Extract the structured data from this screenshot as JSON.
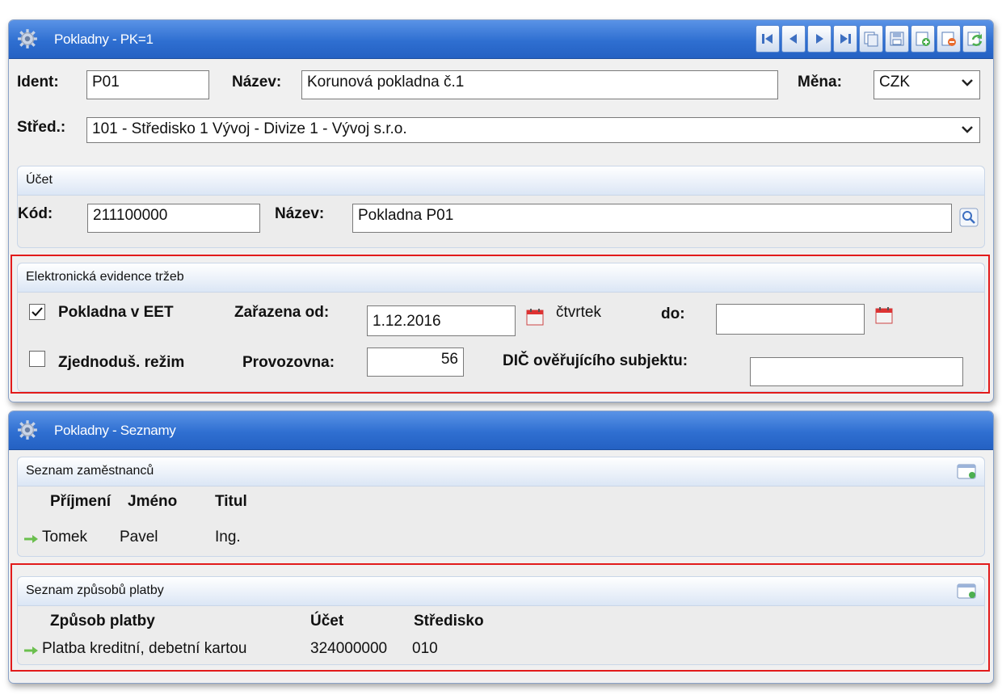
{
  "top_panel": {
    "title": "Pokladny - PK=1",
    "ident_label": "Ident:",
    "ident_value": "P01",
    "nazev_label": "Název:",
    "nazev_value": "Korunová pokladna č.1",
    "mena_label": "Měna:",
    "mena_value": "CZK",
    "stred_label": "Střed.:",
    "stred_value": "101 - Středisko 1 Vývoj - Divize 1 - Vývoj s.r.o.",
    "ucet": {
      "title": "Účet",
      "kod_label": "Kód:",
      "kod_value": "211100000",
      "nazev_label": "Název:",
      "nazev_value": "Pokladna P01"
    },
    "eet": {
      "title": "Elektronická evidence tržeb",
      "pokladna_label": "Pokladna v EET",
      "pokladna_checked": true,
      "zarazena_label": "Zařazena od:",
      "zarazena_value": "1.12.2016",
      "weekday": "čtvrtek",
      "do_label": "do:",
      "do_value": "",
      "zjednodus_label": "Zjednoduš. režim",
      "zjednodus_checked": false,
      "provozovna_label": "Provozovna:",
      "provozovna_value": "56",
      "dic_label": "DIČ ověřujícího subjektu:",
      "dic_value": ""
    }
  },
  "bottom_panel": {
    "title": "Pokladny - Seznamy",
    "employees": {
      "title": "Seznam zaměstnanců",
      "columns": [
        "Příjmení",
        "Jméno",
        "Titul"
      ],
      "rows": [
        [
          "Tomek",
          "Pavel",
          "Ing."
        ]
      ]
    },
    "payments": {
      "title": "Seznam způsobů platby",
      "columns": [
        "Způsob platby",
        "Účet",
        "Středisko"
      ],
      "rows": [
        [
          "Platba kreditní, debetní kartou",
          "324000000",
          "010"
        ]
      ]
    }
  },
  "colors": {
    "titlebar": "#2f6fd1",
    "highlight_frame": "#e21b1b"
  },
  "icons": {
    "toolbar": [
      "first-record-icon",
      "prev-record-icon",
      "next-record-icon",
      "last-record-icon",
      "copy-icon",
      "save-icon",
      "new-record-icon",
      "delete-record-icon",
      "refresh-icon"
    ]
  }
}
